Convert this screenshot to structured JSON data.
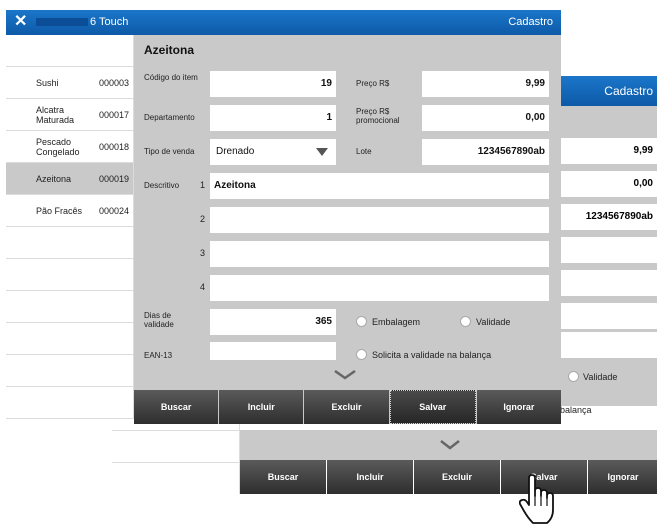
{
  "back_window": {
    "screen_title": "Cadastro",
    "preco": "9,99",
    "preco_promocional": "0,00",
    "lote": "1234567890ab",
    "validade_label": "Validade",
    "balanca_text": "balança",
    "buttons": [
      "Buscar",
      "Incluir",
      "Excluir",
      "Salvar",
      "Ignorar"
    ]
  },
  "front_window": {
    "app_name": "6 Touch",
    "screen_title": "Cadastro",
    "close_icon": "close-icon",
    "products": [
      {
        "name": "Sushi",
        "code": "000003"
      },
      {
        "name": "Alcatra Maturada",
        "code": "000017"
      },
      {
        "name": "Pescado Congelado",
        "code": "000018"
      },
      {
        "name": "Azeitona",
        "code": "000019"
      },
      {
        "name": "Pão Fracês",
        "code": "000024"
      }
    ],
    "form": {
      "title": "Azeitona",
      "codigo_label": "Código do item",
      "codigo_value": "19",
      "preco_label": "Preço R$",
      "preco_value": "9,99",
      "departamento_label": "Departamento",
      "departamento_value": "1",
      "preco_promo_label": "Preço R$ promocional",
      "preco_promo_value": "0,00",
      "tipo_venda_label": "Tipo de venda",
      "tipo_venda_value": "Drenado",
      "lote_label": "Lote",
      "lote_value": "1234567890ab",
      "descritivo_label": "Descritivo",
      "descritivo_lines": [
        "Azeitona",
        "",
        "",
        ""
      ],
      "line_numbers": [
        "1",
        "2",
        "3",
        "4"
      ],
      "dias_validade_label": "Dias de validade",
      "dias_validade_value": "365",
      "embalagem_label": "Embalagem",
      "validade_label": "Validade",
      "ean_label": "EAN-13",
      "ean_value": "",
      "solicita_label": "Solicita a validade na balança"
    },
    "buttons": [
      "Buscar",
      "Incluir",
      "Excluir",
      "Salvar",
      "Ignorar"
    ],
    "active_button": "Salvar"
  }
}
